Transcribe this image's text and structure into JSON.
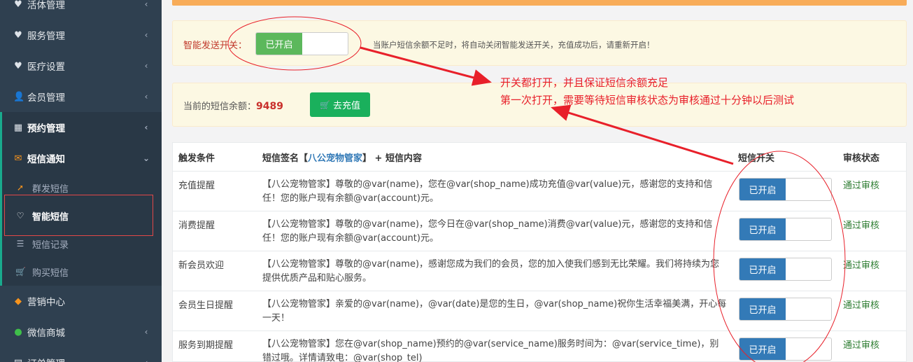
{
  "sidebar": {
    "items": [
      {
        "icon": "heart-icon",
        "label": "活体管理"
      },
      {
        "icon": "heart-icon",
        "label": "服务管理"
      },
      {
        "icon": "heart-icon",
        "label": "医疗设置"
      },
      {
        "icon": "user-icon",
        "label": "会员管理"
      },
      {
        "icon": "calendar-icon",
        "label": "预约管理"
      },
      {
        "icon": "envelope-icon",
        "label": "短信通知"
      }
    ],
    "sub_items": [
      {
        "icon": "paper-plane-icon",
        "label": "群发短信"
      },
      {
        "icon": "heart-outline-icon",
        "label": "智能短信"
      },
      {
        "icon": "list-icon",
        "label": "短信记录"
      },
      {
        "icon": "cart-icon",
        "label": "购买短信"
      }
    ],
    "bottom_items": [
      {
        "icon": "diamond-icon",
        "label": "营销中心"
      },
      {
        "icon": "wechat-icon",
        "label": "微信商城"
      },
      {
        "icon": "doc-icon",
        "label": "订单管理"
      }
    ]
  },
  "smart_send": {
    "label": "智能发送开关：",
    "switch_on_label": "已开启",
    "note": "当账户短信余额不足时，将自动关闭智能发送开关，充值成功后，请重新开启！"
  },
  "balance": {
    "label": "当前的短信余额：",
    "value": "9489",
    "recharge_button": "去充值"
  },
  "annotation": {
    "line1": "开关都打开，并且保证短信余额充足",
    "line2": "第一次打开，需要等待短信审核状态为审核通过十分钟以后测试"
  },
  "table": {
    "headers": {
      "trigger": "触发条件",
      "sig_prefix": "短信签名【",
      "sig_brand": "八公宠物管家",
      "sig_suffix": "】 + 短信内容",
      "switch": "短信开关",
      "status": "审核状态"
    },
    "rows": [
      {
        "trigger": "充值提醒",
        "content": "【八公宠物管家】尊敬的@var(name)，您在@var(shop_name)成功充值@var(value)元，感谢您的支持和信任！您的账户现有余额@var(account)元。",
        "switch": "已开启",
        "status": "通过审核"
      },
      {
        "trigger": "消费提醒",
        "content": "【八公宠物管家】尊敬的@var(name)，您今日在@var(shop_name)消费@var(value)元，感谢您的支持和信任！您的账户现有余额@var(account)元。",
        "switch": "已开启",
        "status": "通过审核"
      },
      {
        "trigger": "新会员欢迎",
        "content": "【八公宠物管家】尊敬的@var(name)，感谢您成为我们的会员，您的加入使我们感到无比荣耀。我们将持续为您提供优质产品和贴心服务。",
        "switch": "已开启",
        "status": "通过审核"
      },
      {
        "trigger": "会员生日提醒",
        "content": "【八公宠物管家】亲爱的@var(name)，@var(date)是您的生日，@var(shop_name)祝你生活幸福美满，开心每一天！",
        "switch": "已开启",
        "status": "通过审核"
      },
      {
        "trigger": "服务到期提醒",
        "content": "【八公宠物管家】您在@var(shop_name)预约的@var(service_name)服务时间为：@var(service_time)，别错过哦。详情请致电：@var(shop_tel)",
        "switch": "已开启",
        "status": "通过审核"
      }
    ]
  },
  "colors": {
    "sidebar_bg": "#2f4050",
    "accent_green": "#1ab05c",
    "switch_blue": "#337ab7",
    "annotation_red": "#e8202a"
  }
}
